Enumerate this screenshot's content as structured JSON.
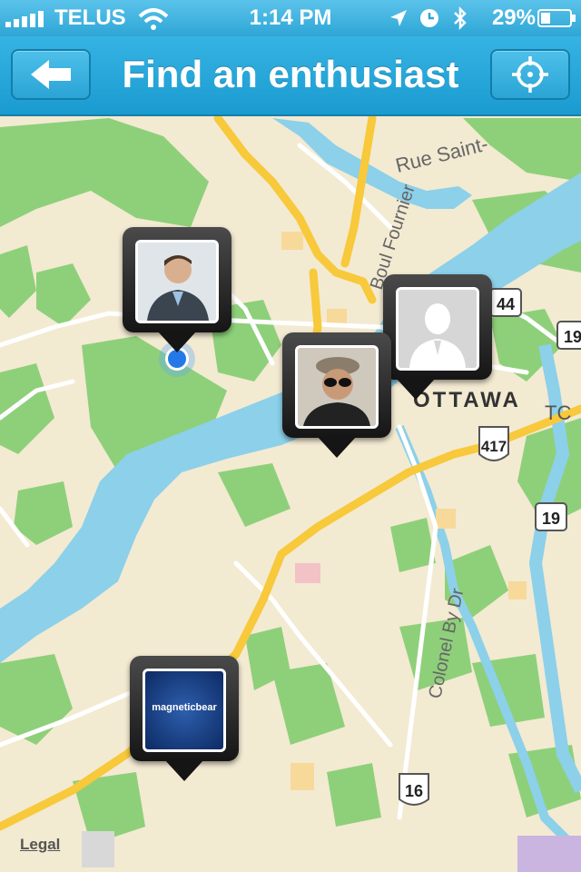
{
  "status_bar": {
    "carrier": "TELUS",
    "time": "1:14 PM",
    "battery": "29%",
    "icons": [
      "signal-bars-icon",
      "wifi-icon",
      "location-arrow-icon",
      "clock-icon",
      "bluetooth-icon",
      "battery-icon"
    ]
  },
  "nav": {
    "title": "Find an enthusiast",
    "back_icon": "back-arrow-icon",
    "locate_icon": "crosshair-icon"
  },
  "map": {
    "labels": {
      "rue_saint": "Rue Saint-",
      "boul_fournier": "Boul Fournier",
      "ottawa": "OTTAWA",
      "tc": "TC",
      "colonel_by": "Colonel By Dr"
    },
    "shields": {
      "h44": "44",
      "h19a": "19",
      "h417": "417",
      "h19b": "19",
      "h16": "16"
    },
    "legal": "Legal",
    "colors": {
      "land": "#f3ead2",
      "water": "#8cd0ea",
      "park": "#8ed07a",
      "highway": "#f7c93b",
      "road": "#ffffff",
      "pin": "#1a1a1a",
      "nav": "#1ea0d3"
    }
  },
  "pins": [
    {
      "name": "person-photo-1",
      "kind": "photo"
    },
    {
      "name": "default-avatar",
      "kind": "placeholder"
    },
    {
      "name": "person-photo-2",
      "kind": "photo"
    },
    {
      "name": "magnetic-bear-logo",
      "kind": "logo",
      "text": "magneticbear"
    }
  ]
}
